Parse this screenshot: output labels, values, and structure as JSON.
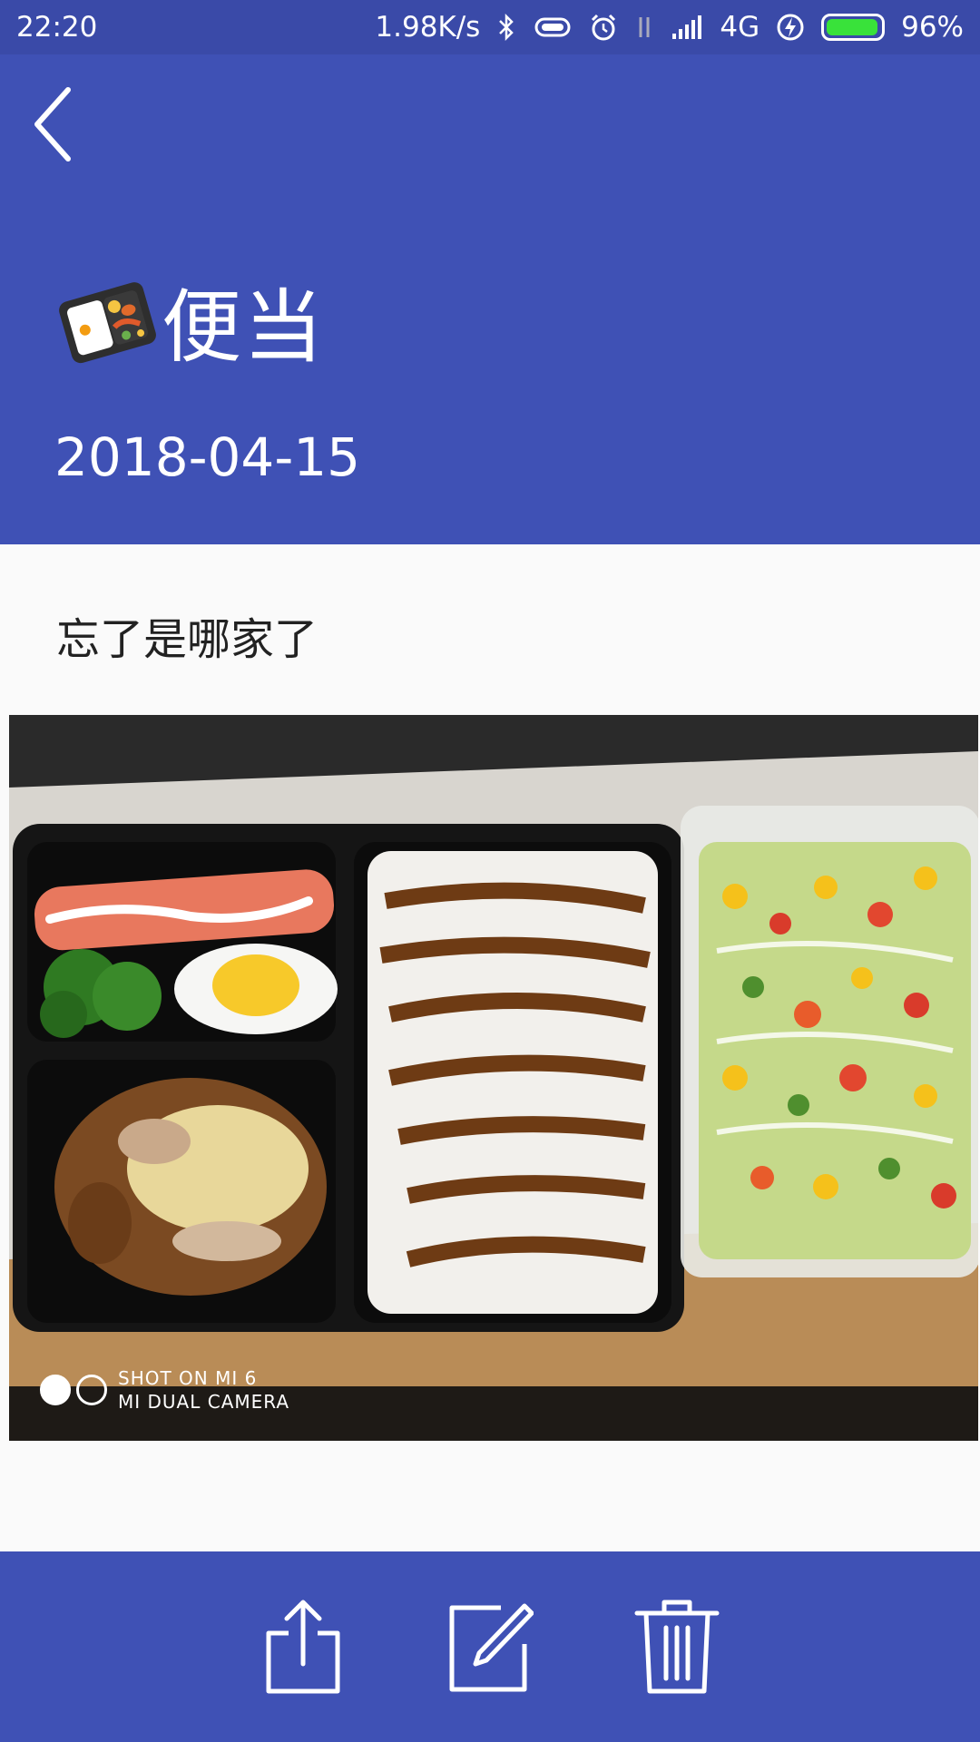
{
  "status_bar": {
    "time": "22:20",
    "speed": "1.98K/s",
    "network": "4G",
    "battery": "96%",
    "battery_level": 0.96,
    "icons": [
      "bluetooth-icon",
      "vibrate-icon",
      "alarm-icon",
      "data-arrows-icon",
      "signal-icon",
      "charging-icon",
      "battery-icon"
    ],
    "battery_color": "#39e23a"
  },
  "header": {
    "back_icon": "chevron-left-icon",
    "emoji_icon": "bento-box-icon",
    "title": "便当",
    "date": "2018-04-15",
    "color": "#3f51b5"
  },
  "body": {
    "note": "忘了是哪家了",
    "photo": {
      "watermark_line1": "SHOT ON MI 6",
      "watermark_line2": "MI DUAL CAMERA"
    }
  },
  "bottom_bar": {
    "actions": [
      "share-icon",
      "edit-icon",
      "delete-icon"
    ],
    "color": "#3f51b5"
  }
}
